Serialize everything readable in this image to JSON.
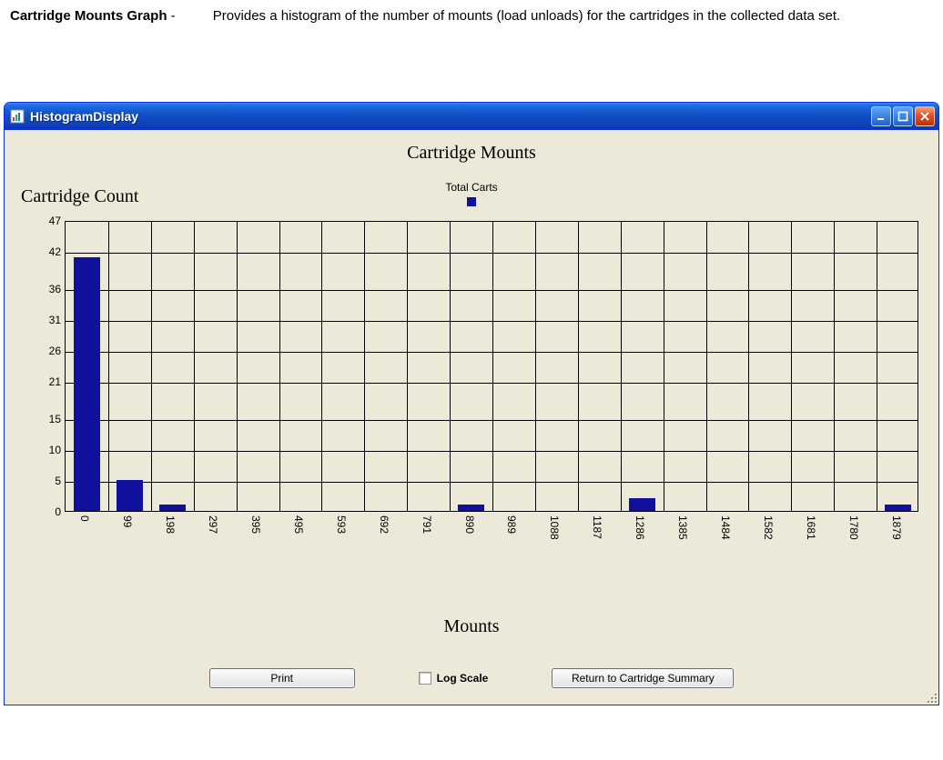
{
  "doc": {
    "label": "Cartridge Mounts Graph",
    "dash": " - ",
    "description": "Provides a histogram of the number of mounts (load unloads) for the cartridges in the collected data set."
  },
  "window": {
    "title": "HistogramDisplay"
  },
  "chart_data": {
    "type": "bar",
    "title": "Cartridge Mounts",
    "xlabel": "Mounts",
    "ylabel": "Cartridge Count",
    "legend": "Total Carts",
    "ylim": [
      0,
      47
    ],
    "yticks": [
      0,
      5,
      10,
      15,
      21,
      26,
      31,
      36,
      42,
      47
    ],
    "categories": [
      "0",
      "99",
      "198",
      "297",
      "395",
      "495",
      "593",
      "692",
      "791",
      "890",
      "989",
      "1088",
      "1187",
      "1286",
      "1385",
      "1484",
      "1582",
      "1681",
      "1780",
      "1879"
    ],
    "values": [
      41,
      5,
      1,
      0,
      0,
      0,
      0,
      0,
      0,
      1,
      0,
      0,
      0,
      2,
      0,
      0,
      0,
      0,
      0,
      1
    ],
    "bar_color": "#10109c"
  },
  "controls": {
    "print": "Print",
    "log_scale": "Log Scale",
    "log_scale_checked": false,
    "return": "Return to Cartridge Summary"
  }
}
